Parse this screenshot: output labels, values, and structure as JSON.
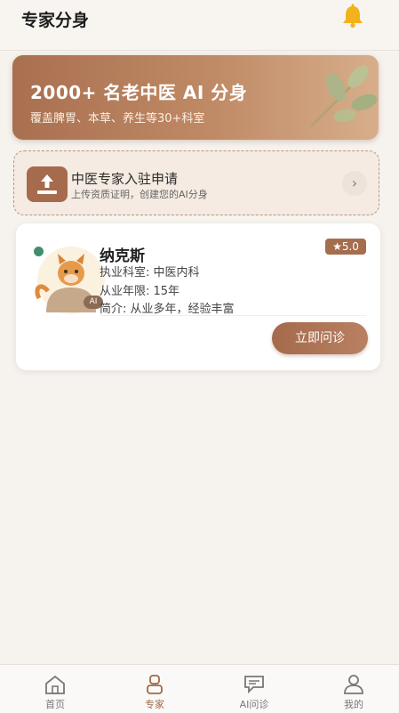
{
  "header": {
    "title": "专家分身",
    "bell_icon": "bell-icon",
    "bell_color": "#f2b21b"
  },
  "banner": {
    "title": "2000+ 名老中医 AI 分身",
    "subtitle": "覆盖脾胃、本草、养生等30+科室",
    "decor_icon": "leaf-icon"
  },
  "apply": {
    "title": "中医专家入驻申请",
    "subtitle": "上传资质证明，创建您的AI分身",
    "icon": "upload-icon",
    "arrow": "›"
  },
  "doctor": {
    "name": "纳克斯",
    "rating": "★5.0",
    "ai_tag": "AI",
    "department": "执业科室: 中医内科",
    "years": "从业年限: 15年",
    "intro": "简介: 从业多年，经验丰富",
    "action": "立即问诊"
  },
  "tabbar": {
    "items": [
      {
        "label": "首页",
        "icon": "home-icon",
        "active": false
      },
      {
        "label": "专家",
        "icon": "expert-icon",
        "active": true
      },
      {
        "label": "AI问诊",
        "icon": "chat-icon",
        "active": false
      },
      {
        "label": "我的",
        "icon": "user-icon",
        "active": false
      }
    ]
  },
  "colors": {
    "accent": "#a66b4c",
    "background": "#f6f2ee"
  }
}
